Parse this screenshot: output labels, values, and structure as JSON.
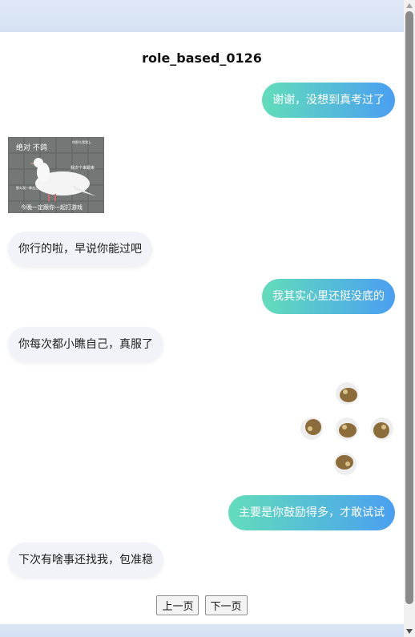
{
  "page": {
    "title": "role_based_0126"
  },
  "messages": [
    {
      "side": "right",
      "type": "text",
      "text": "谢谢，没想到真考过了"
    },
    {
      "side": "left",
      "type": "sticker",
      "sticker": "dove-sticker",
      "caption_lines": [
        "绝对 不鸽",
        "你那么我我上",
        "我次个来跟来",
        "那么我一拳击之",
        "今晚一定跟你一起打游戏"
      ]
    },
    {
      "side": "left",
      "type": "text",
      "text": "你行的啦，早说你能过吧"
    },
    {
      "side": "right",
      "type": "text",
      "text": "我其实心里还挺没底的"
    },
    {
      "side": "left",
      "type": "text",
      "text": "你每次都小瞧自己，真服了"
    },
    {
      "side": "right",
      "type": "sticker",
      "sticker": "spinning-dog-sticker"
    },
    {
      "side": "right",
      "type": "text",
      "text": "主要是你鼓励得多，才敢试试"
    },
    {
      "side": "left",
      "type": "text",
      "text": "下次有啥事还找我，包准稳"
    }
  ],
  "pager": {
    "prev_label": "上一页",
    "next_label": "下一页"
  },
  "colors": {
    "bubble_gradient_start": "#62ddbb",
    "bubble_gradient_end": "#4a9ff1",
    "left_bubble": "#f1f3f8",
    "background_band": "#dbe6f5"
  }
}
